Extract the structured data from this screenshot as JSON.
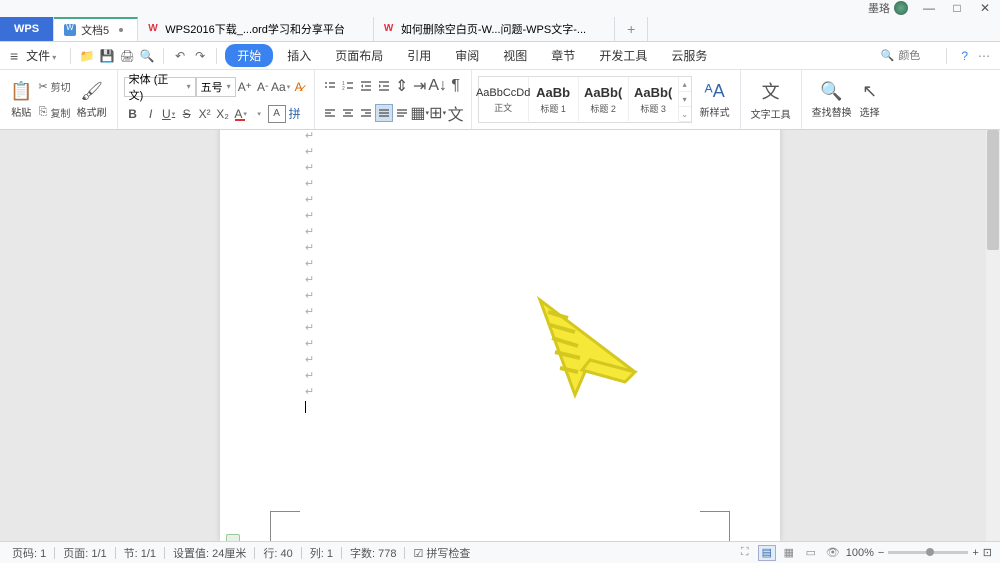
{
  "titlebar": {
    "username": "墨珞"
  },
  "tabs": {
    "app": "WPS",
    "doc": "文档5",
    "web1": "WPS2016下载_...ord学习和分享平台",
    "web2": "如何删除空白页-W...问题-WPS文字-..."
  },
  "menu": {
    "file": "文件",
    "ribbons": [
      "开始",
      "插入",
      "页面布局",
      "引用",
      "审阅",
      "视图",
      "章节",
      "开发工具",
      "云服务"
    ],
    "search_placeholder": "颜色"
  },
  "ribbon": {
    "paste": "粘贴",
    "cut": "剪切",
    "copy": "复制",
    "format_painter": "格式刷",
    "font_name": "宋体 (正文)",
    "font_size": "五号",
    "styles": [
      {
        "preview": "AaBbCcDd",
        "name": "正文"
      },
      {
        "preview": "AaBb",
        "name": "标题 1"
      },
      {
        "preview": "AaBb(",
        "name": "标题 2"
      },
      {
        "preview": "AaBb(",
        "name": "标题 3"
      }
    ],
    "new_style": "新样式",
    "text_tools": "文字工具",
    "find_replace": "查找替换",
    "select": "选择"
  },
  "status": {
    "page_no": "页码: 1",
    "page": "页面: 1/1",
    "section": "节: 1/1",
    "setting": "设置值: 24厘米",
    "line": "行: 40",
    "col": "列: 1",
    "words": "字数: 778",
    "spell": "拼写检查",
    "zoom": "100%"
  }
}
